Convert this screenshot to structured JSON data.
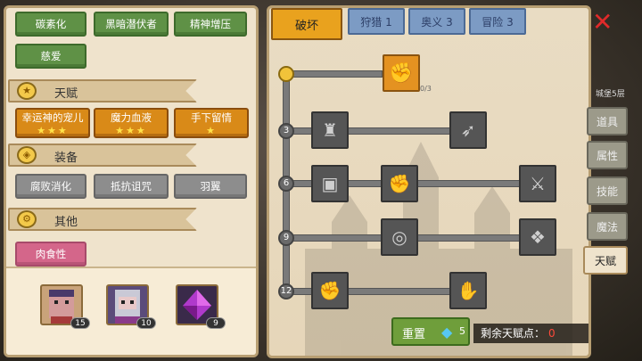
{
  "left": {
    "row1": [
      "碳素化",
      "黑暗潜伏者",
      "精神增压"
    ],
    "row2": [
      "慈爱"
    ],
    "talent_section": {
      "label": "天赋",
      "icon": "star-icon"
    },
    "talents": [
      {
        "label": "幸运神的宠儿",
        "stars": "★★★"
      },
      {
        "label": "魔力血液",
        "stars": "★★★"
      },
      {
        "label": "手下留情",
        "stars": "★"
      }
    ],
    "equip_section": {
      "label": "装备",
      "icon": "armor-icon"
    },
    "equips": [
      "腐败消化",
      "抵抗诅咒",
      "羽翼"
    ],
    "other_section": {
      "label": "其他",
      "icon": "gear-icon"
    },
    "others": [
      "肉食性"
    ],
    "inventory": [
      {
        "name": "hero-portrait-1",
        "count": "15"
      },
      {
        "name": "hero-portrait-2",
        "count": "10"
      },
      {
        "name": "purple-crystal",
        "count": "9"
      }
    ]
  },
  "right": {
    "tabs": {
      "active": "破坏",
      "others": [
        "狩猎 1",
        "奥义 3",
        "冒险 3"
      ]
    },
    "top_skill_progress": "0/3",
    "levels": [
      "3",
      "6",
      "9",
      "12"
    ],
    "reset": {
      "label": "重置",
      "gems": "5"
    },
    "remaining": {
      "label": "剩余天赋点：",
      "value": "0"
    }
  },
  "side": {
    "floor": "城堡5层",
    "tabs": [
      "道具",
      "属性",
      "技能",
      "魔法",
      "天赋"
    ],
    "active_tab": "天赋"
  },
  "colors": {
    "accent": "#e9a21e",
    "talent_gold": "#d98a18",
    "green": "#5f9146",
    "close": "#e02a2a"
  }
}
